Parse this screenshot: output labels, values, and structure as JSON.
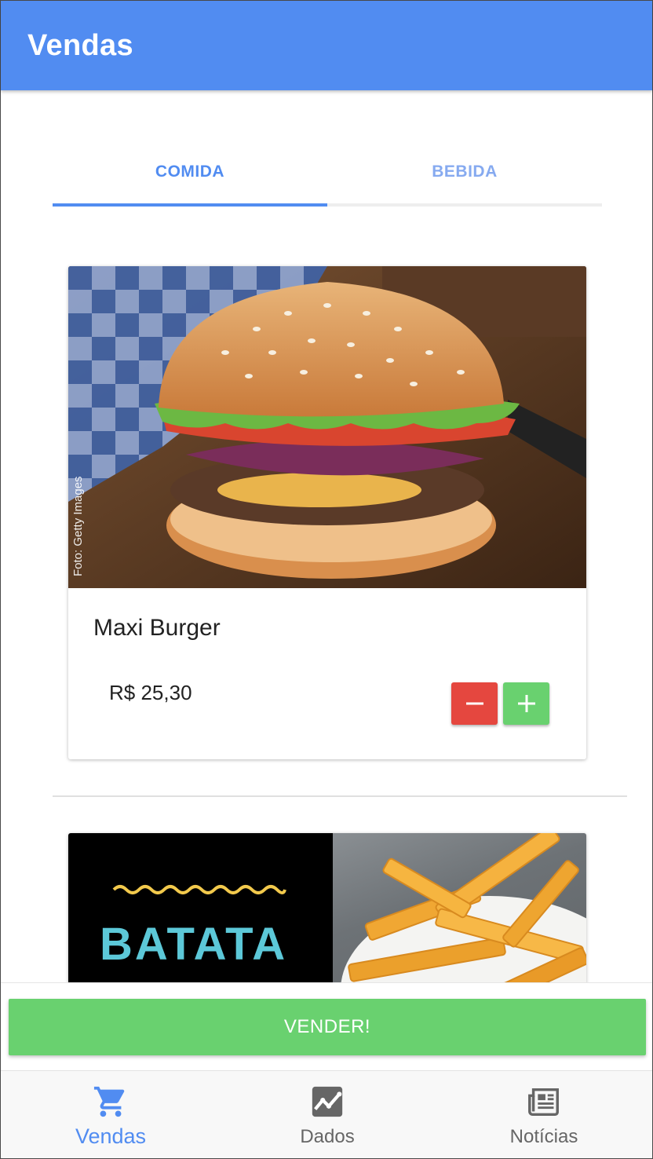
{
  "app_bar": {
    "title": "Vendas"
  },
  "tabs": [
    {
      "label": "COMIDA",
      "active": true
    },
    {
      "label": "BEBIDA",
      "active": false
    }
  ],
  "products": [
    {
      "name": "Maxi Burger",
      "price": "R$ 25,30",
      "image_icon": "burger-photo",
      "photo_credit": "Foto: Getty Images"
    },
    {
      "image_icon": "fries-photo",
      "brand_text": "BATATA"
    }
  ],
  "actions": {
    "sell_label": "VENDER!"
  },
  "bottom_nav": [
    {
      "label": "Vendas",
      "icon": "cart-icon",
      "active": true
    },
    {
      "label": "Dados",
      "icon": "chart-icon",
      "active": false
    },
    {
      "label": "Notícias",
      "icon": "newspaper-icon",
      "active": false
    }
  ],
  "colors": {
    "primary": "#518cf1",
    "tab_inactive": "#86aaf0",
    "minus_button": "#e5473f",
    "plus_button": "#69d16f",
    "sell_button": "#69d16f",
    "fries_text": "#5cc8d8",
    "fries_wave": "#f2c94c"
  }
}
